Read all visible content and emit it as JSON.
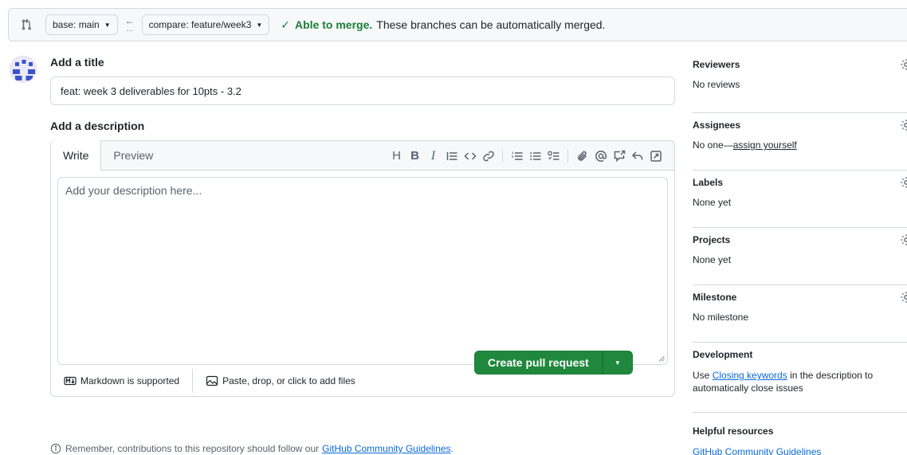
{
  "compare_bar": {
    "base_label": "base: main",
    "compare_label": "compare: feature/week3",
    "merge_ok": "Able to merge.",
    "merge_desc": "These branches can be automatically merged."
  },
  "main": {
    "title_label": "Add a title",
    "title_value": "feat: week 3 deliverables for 10pts - 3.2",
    "description_label": "Add a description",
    "tabs": [
      {
        "label": "Write",
        "active": true
      },
      {
        "label": "Preview",
        "active": false
      }
    ],
    "description_placeholder": "Add your description here...",
    "markdown_label": "Markdown is supported",
    "attach_label": "Paste, drop, or click to add files",
    "create_button": "Create pull request",
    "remember_prefix": "Remember, contributions to this repository should follow our",
    "remember_link": "GitHub Community Guidelines",
    "remember_suffix": "."
  },
  "sidebar": {
    "reviewers": {
      "title": "Reviewers",
      "value": "No reviews"
    },
    "assignees": {
      "title": "Assignees",
      "value_prefix": "No one—",
      "value_link": "assign yourself"
    },
    "labels": {
      "title": "Labels",
      "value": "None yet"
    },
    "projects": {
      "title": "Projects",
      "value": "None yet"
    },
    "milestone": {
      "title": "Milestone",
      "value": "No milestone"
    },
    "development": {
      "title": "Development",
      "text_prefix": "Use",
      "text_link": "Closing keywords",
      "text_suffix": "in the description to automatically close issues"
    },
    "helpful": {
      "title": "Helpful resources",
      "link": "GitHub Community Guidelines"
    }
  },
  "colors": {
    "primary_green": "#1f883d",
    "success_text": "#1a7f37",
    "link_blue": "#0969da",
    "border": "#d1d9e0",
    "muted_text": "#59636e"
  },
  "icons": {
    "compare": "git-compare-icon",
    "arrow": "arrow-left-icon",
    "check": "check-icon",
    "gear": "gear-icon",
    "markdown": "markdown-icon",
    "image": "image-icon",
    "info": "info-icon"
  }
}
